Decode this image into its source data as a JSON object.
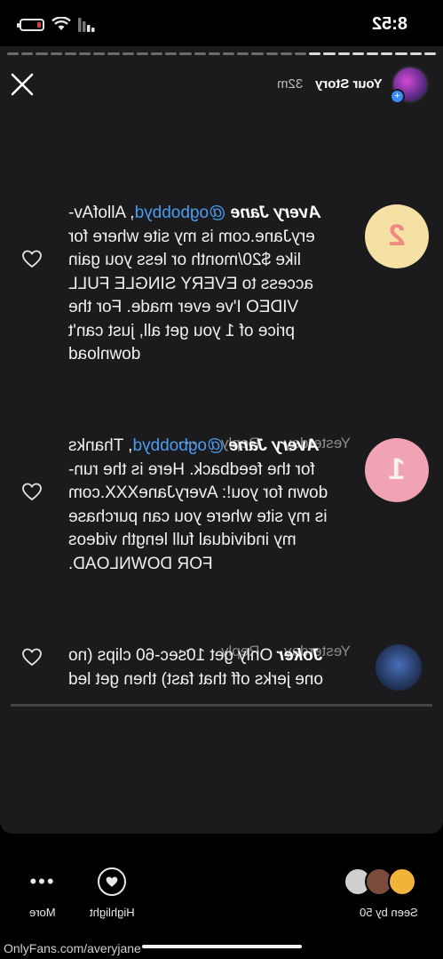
{
  "status_bar": {
    "time": "8:52"
  },
  "story": {
    "owner": "Your Story",
    "age": "32m"
  },
  "comments": [
    {
      "badge": "2",
      "author": "Avery Jane",
      "mention": "@ogbobbyd",
      "body": ", AllofAv-\neryJane.com is my site where for\nlike $20/month or less you gain\naccess to EVERY SINGLE FULL\nVIDEO I've ever made. For the\nprice of 1 you get all, just can't\ndownload",
      "time": "Yesterday",
      "reply": "Reply",
      "more": "···"
    },
    {
      "badge": "1",
      "author": "Avery Jane",
      "mention": "@ogbobbyd",
      "body": ", Thanks\nfor the feedback. Here is the run-\ndown for you!: AveryJaneXXX.com\nis my site where you can purchase\nmy individual full length videos\nFOR DOWNLOAD.",
      "time": "Yesterday",
      "reply": "Reply",
      "more": "···"
    },
    {
      "author": "Joker",
      "body": " Only get 10sec-60 clips (no\none jerks off that fast) then get led"
    }
  ],
  "bottom_bar": {
    "more_label": "More",
    "highlight_label": "Highlight",
    "seen_label": "Seen by 50"
  },
  "footer": {
    "url": "OnlyFans.com/averyjane"
  },
  "colors": {
    "mention": "#4a9cf0",
    "badge_two_bg": "#f5e1a4",
    "badge_two_fg": "#f08a80",
    "badge_one_bg": "#f2a3b3",
    "badge_one_fg": "#f7f3e6"
  }
}
